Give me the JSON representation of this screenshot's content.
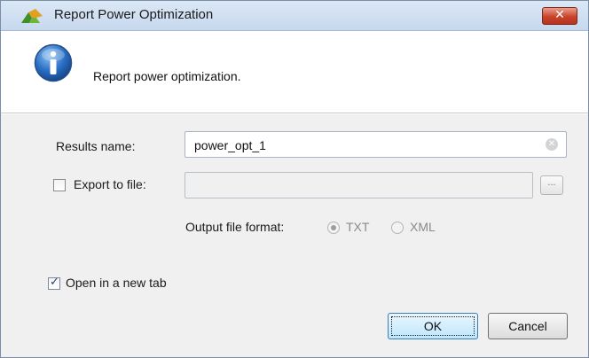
{
  "window": {
    "title": "Report Power Optimization",
    "close_glyph": "✕",
    "logo_icon": "vivado-logo-icon"
  },
  "header": {
    "icon": "info-icon",
    "message": "Report power optimization."
  },
  "form": {
    "results_label": "Results name:",
    "results_value": "power_opt_1",
    "clear_glyph": "✕",
    "export_label": "Export to file:",
    "export_checked": false,
    "export_value": "",
    "browse_label": "...",
    "format_label": "Output file format:",
    "format_options": [
      {
        "label": "TXT",
        "selected": true
      },
      {
        "label": "XML",
        "selected": false
      }
    ],
    "open_tab_label": "Open in a new tab",
    "open_tab_checked": true,
    "check_glyph": "✓"
  },
  "buttons": {
    "ok": "OK",
    "cancel": "Cancel"
  },
  "colors": {
    "title_bar": "#c7d8ee",
    "close_red": "#c9432b",
    "ok_accent": "#3c7fb1"
  }
}
